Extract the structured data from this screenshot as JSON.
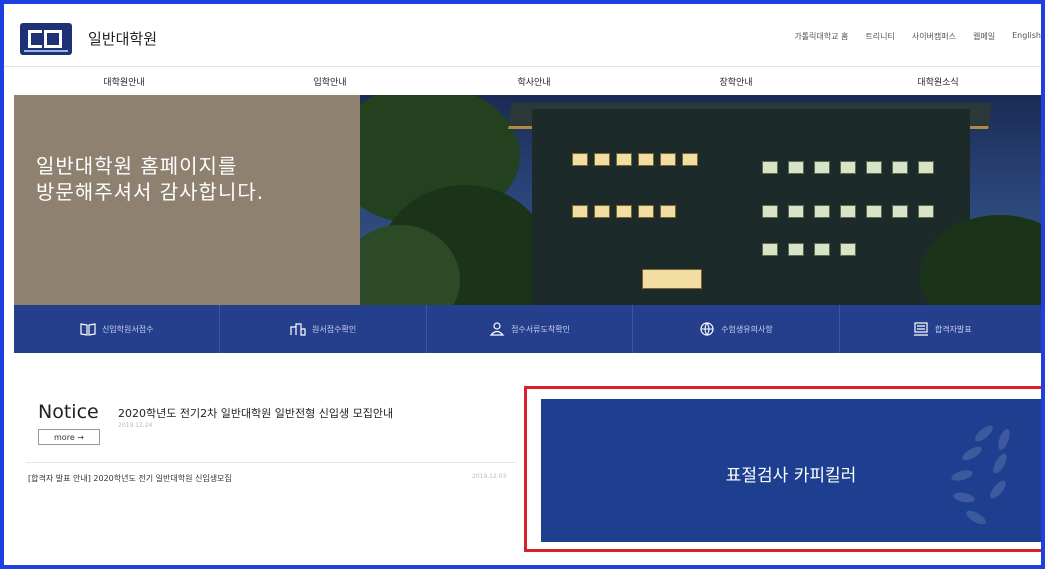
{
  "header": {
    "site_title": "일반대학원",
    "util_links": [
      "가톨릭대학교 홈",
      "트리니티",
      "사이버캠퍼스",
      "웹메일",
      "English"
    ]
  },
  "gnb": {
    "items": [
      "대학원안내",
      "입학안내",
      "학사안내",
      "장학안내",
      "대학원소식"
    ]
  },
  "hero": {
    "line1": "일반대학원 홈페이지를",
    "line2": "방문해주셔서 감사합니다."
  },
  "quick_menu": {
    "items": [
      {
        "label": "신입학원서접수",
        "icon": "book-icon"
      },
      {
        "label": "원서접수확인",
        "icon": "building-icon"
      },
      {
        "label": "접수서류도착확인",
        "icon": "person-icon"
      },
      {
        "label": "수험생유의사항",
        "icon": "globe-icon"
      },
      {
        "label": "합격자발표",
        "icon": "board-icon"
      }
    ]
  },
  "notice": {
    "heading": "Notice",
    "featured_title": "2020학년도 전기2차 일반대학원 일반전형 신입생 모집안내",
    "featured_date": "2019.12.24",
    "more_label": "more →",
    "item_title": "[합격자 발표 안내] 2020학년도 전기 일반대학원 신입생모집",
    "item_date": "2019.12.03"
  },
  "banner": {
    "text": "표절검사 카피킬러"
  },
  "colors": {
    "frame": "#1f3fe0",
    "quick_menu_bg": "#263f8c",
    "banner_bg": "#1e3f90",
    "highlight": "#d8212b",
    "hero_left_bg": "#8f8170"
  }
}
